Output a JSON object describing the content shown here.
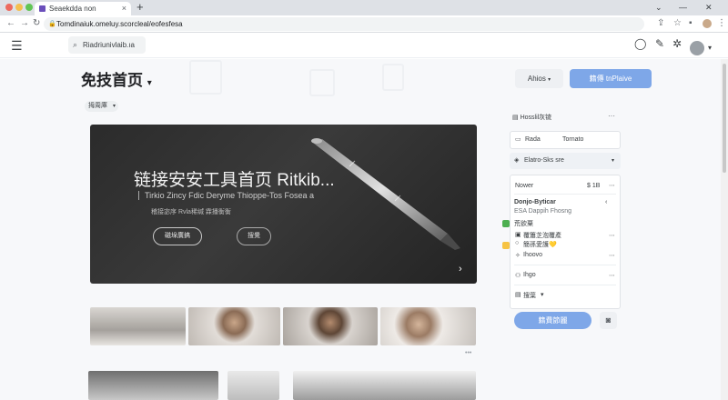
{
  "browser": {
    "tab_title": "Seaekdda non",
    "tab_close": "×",
    "new_tab": "+",
    "url": "Tomdinaiuk.omeluy.scorcleal/eofesfesa",
    "win_min": "⌄",
    "win_max": "—",
    "win_close": "✕"
  },
  "header": {
    "search_text": "Riadriunivlaib.ıa"
  },
  "page": {
    "title": "免技首页",
    "filter_label": "拇周庫",
    "action_secondary": "Ahios",
    "action_primary": "籍傳 tnPlaive"
  },
  "hero": {
    "title": "链接安安工具首页 Ritkib...",
    "subtitle": "Tirkio Zincy Fdic Deryme Thioppe-Tos Fosea a",
    "description": "稽接宓序 Rvla稀缄 霖播衡衡",
    "button_primary": "磁垛廣搞",
    "button_secondary": "搜覺"
  },
  "panel": {
    "header": "Hosslil灰锍",
    "field_label": "Rada",
    "field_value": "Tornato",
    "select_label": "Elatro-Sks sre",
    "list_item_1_label": "Nower",
    "list_item_1_value": "$ 1B",
    "section_title": "Donjo-Byticar",
    "section_sub": "ESA Dappih Fhosng",
    "option_1": "荒欲粟",
    "option_2": "覆簫芝泡覆產",
    "option_3": "簡孫愛護💛",
    "option_4": "Ihoovo",
    "option_5": "Ihgo",
    "option_6": "搜葉",
    "submit_label": "籍費節麗"
  },
  "colors": {
    "primary": "#7ea7e8",
    "checkbox_green": "#4caf50",
    "checkbox_yellow": "#f6c343"
  }
}
